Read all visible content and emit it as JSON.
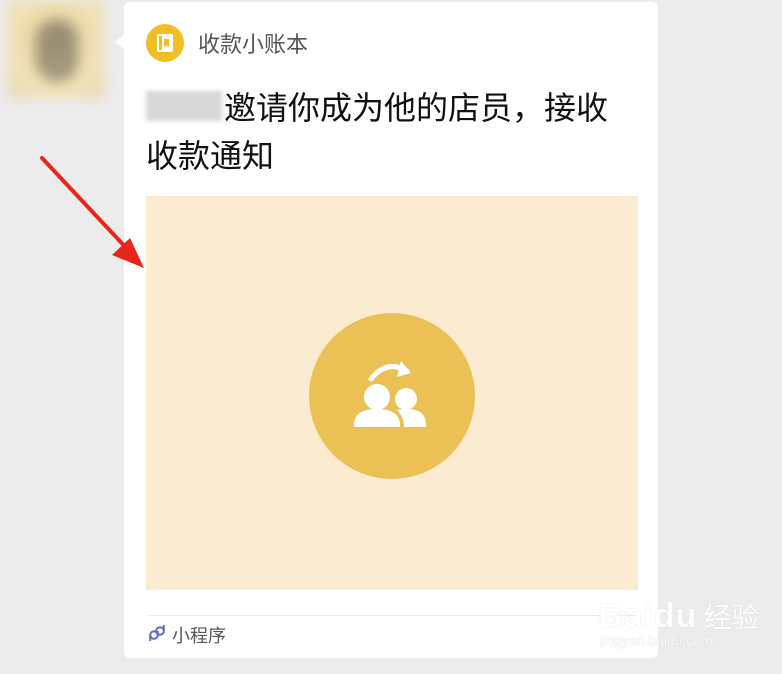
{
  "app": {
    "name": "收款小账本",
    "logo_icon": "ledger-book-icon",
    "logo_color": "#f1be25"
  },
  "message": {
    "text": "邀请你成为他的店员，接收收款通知"
  },
  "preview": {
    "background": "#fbebd0",
    "circle_color": "#ebc054",
    "icon": "invite-staff-icon"
  },
  "footer": {
    "label": "小程序",
    "icon": "mini-program-icon"
  },
  "annotation": {
    "arrow_color": "#e8261c"
  },
  "watermark": {
    "brand": "Baidu",
    "text": "经验",
    "url": "jingyan.baidu.com"
  }
}
